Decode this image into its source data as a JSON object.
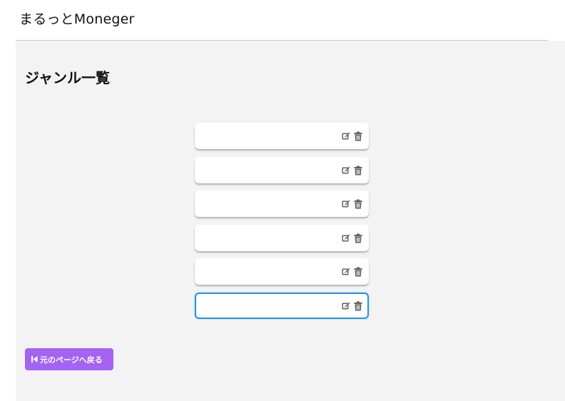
{
  "header": {
    "app_title": "まるっとMoneger"
  },
  "main": {
    "page_title": "ジャンル一覧",
    "genres": [
      {
        "name": ""
      },
      {
        "name": ""
      },
      {
        "name": ""
      },
      {
        "name": ""
      },
      {
        "name": ""
      },
      {
        "name": ""
      }
    ],
    "active_index": 5,
    "back_button_label": "元のページへ戻る",
    "icons": {
      "edit": "edit-icon",
      "delete": "trash-icon",
      "back": "skip-back-icon"
    }
  },
  "colors": {
    "accent": "#a463f2",
    "focus_border": "#1e96e6",
    "background": "#f3f3f3"
  }
}
